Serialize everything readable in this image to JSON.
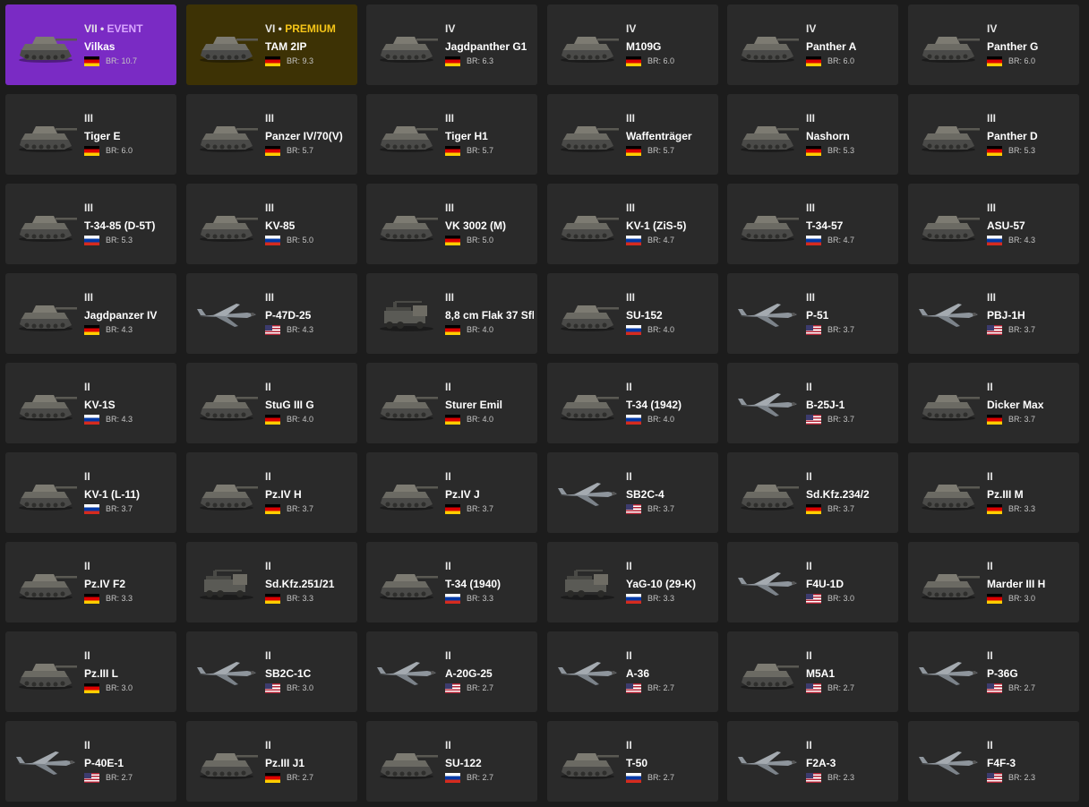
{
  "colors": {
    "page_background": "#1c1c1c",
    "card_background": "#2a2a2a",
    "event_background": "#7a2bc4",
    "premium_background": "#3d3205",
    "event_accent": "#d9a6ff",
    "premium_accent": "#f5c518"
  },
  "vehicles": [
    {
      "tier": "VII",
      "tag": "EVENT",
      "name": "Vilkas",
      "nation": "de",
      "br": "BR: 10.7",
      "kind": "tank",
      "variant": "event"
    },
    {
      "tier": "VI",
      "tag": "PREMIUM",
      "name": "TAM 2IP",
      "nation": "de",
      "br": "BR: 9.3",
      "kind": "tank",
      "variant": "premium"
    },
    {
      "tier": "IV",
      "name": "Jagdpanther G1",
      "nation": "de",
      "br": "BR: 6.3",
      "kind": "tank"
    },
    {
      "tier": "IV",
      "name": "M109G",
      "nation": "de",
      "br": "BR: 6.0",
      "kind": "tank"
    },
    {
      "tier": "IV",
      "name": "Panther A",
      "nation": "de",
      "br": "BR: 6.0",
      "kind": "tank"
    },
    {
      "tier": "IV",
      "name": "Panther G",
      "nation": "de",
      "br": "BR: 6.0",
      "kind": "tank"
    },
    {
      "tier": "III",
      "name": "Tiger E",
      "nation": "de",
      "br": "BR: 6.0",
      "kind": "tank"
    },
    {
      "tier": "III",
      "name": "Panzer IV/70(V)",
      "nation": "de",
      "br": "BR: 5.7",
      "kind": "tank"
    },
    {
      "tier": "III",
      "name": "Tiger H1",
      "nation": "de",
      "br": "BR: 5.7",
      "kind": "tank"
    },
    {
      "tier": "III",
      "name": "Waffenträger",
      "nation": "de",
      "br": "BR: 5.7",
      "kind": "tank"
    },
    {
      "tier": "III",
      "name": "Nashorn",
      "nation": "de",
      "br": "BR: 5.3",
      "kind": "tank"
    },
    {
      "tier": "III",
      "name": "Panther D",
      "nation": "de",
      "br": "BR: 5.3",
      "kind": "tank"
    },
    {
      "tier": "III",
      "name": "T-34-85 (D-5T)",
      "nation": "ru",
      "br": "BR: 5.3",
      "kind": "tank"
    },
    {
      "tier": "III",
      "name": "KV-85",
      "nation": "ru",
      "br": "BR: 5.0",
      "kind": "tank"
    },
    {
      "tier": "III",
      "name": "VK 3002 (M)",
      "nation": "de",
      "br": "BR: 5.0",
      "kind": "tank"
    },
    {
      "tier": "III",
      "name": "KV-1 (ZiS-5)",
      "nation": "ru",
      "br": "BR: 4.7",
      "kind": "tank"
    },
    {
      "tier": "III",
      "name": "T-34-57",
      "nation": "ru",
      "br": "BR: 4.7",
      "kind": "tank"
    },
    {
      "tier": "III",
      "name": "ASU-57",
      "nation": "ru",
      "br": "BR: 4.3",
      "kind": "tank"
    },
    {
      "tier": "III",
      "name": "Jagdpanzer IV",
      "nation": "de",
      "br": "BR: 4.3",
      "kind": "tank"
    },
    {
      "tier": "III",
      "name": "P-47D-25",
      "nation": "us",
      "br": "BR: 4.3",
      "kind": "plane"
    },
    {
      "tier": "III",
      "name": "8,8 cm Flak 37 Sfl.",
      "nation": "de",
      "br": "BR: 4.0",
      "kind": "truck"
    },
    {
      "tier": "III",
      "name": "SU-152",
      "nation": "ru",
      "br": "BR: 4.0",
      "kind": "tank"
    },
    {
      "tier": "III",
      "name": "P-51",
      "nation": "us",
      "br": "BR: 3.7",
      "kind": "plane"
    },
    {
      "tier": "III",
      "name": "PBJ-1H",
      "nation": "us",
      "br": "BR: 3.7",
      "kind": "plane"
    },
    {
      "tier": "II",
      "name": "KV-1S",
      "nation": "ru",
      "br": "BR: 4.3",
      "kind": "tank"
    },
    {
      "tier": "II",
      "name": "StuG III G",
      "nation": "de",
      "br": "BR: 4.0",
      "kind": "tank"
    },
    {
      "tier": "II",
      "name": "Sturer Emil",
      "nation": "de",
      "br": "BR: 4.0",
      "kind": "tank"
    },
    {
      "tier": "II",
      "name": "T-34 (1942)",
      "nation": "ru",
      "br": "BR: 4.0",
      "kind": "tank"
    },
    {
      "tier": "II",
      "name": "B-25J-1",
      "nation": "us",
      "br": "BR: 3.7",
      "kind": "plane"
    },
    {
      "tier": "II",
      "name": "Dicker Max",
      "nation": "de",
      "br": "BR: 3.7",
      "kind": "tank"
    },
    {
      "tier": "II",
      "name": "KV-1 (L-11)",
      "nation": "ru",
      "br": "BR: 3.7",
      "kind": "tank"
    },
    {
      "tier": "II",
      "name": "Pz.IV H",
      "nation": "de",
      "br": "BR: 3.7",
      "kind": "tank"
    },
    {
      "tier": "II",
      "name": "Pz.IV J",
      "nation": "de",
      "br": "BR: 3.7",
      "kind": "tank"
    },
    {
      "tier": "II",
      "name": "SB2C-4",
      "nation": "us",
      "br": "BR: 3.7",
      "kind": "plane"
    },
    {
      "tier": "II",
      "name": "Sd.Kfz.234/2",
      "nation": "de",
      "br": "BR: 3.7",
      "kind": "tank"
    },
    {
      "tier": "II",
      "name": "Pz.III M",
      "nation": "de",
      "br": "BR: 3.3",
      "kind": "tank"
    },
    {
      "tier": "II",
      "name": "Pz.IV F2",
      "nation": "de",
      "br": "BR: 3.3",
      "kind": "tank"
    },
    {
      "tier": "II",
      "name": "Sd.Kfz.251/21",
      "nation": "de",
      "br": "BR: 3.3",
      "kind": "truck"
    },
    {
      "tier": "II",
      "name": "T-34 (1940)",
      "nation": "ru",
      "br": "BR: 3.3",
      "kind": "tank"
    },
    {
      "tier": "II",
      "name": "YaG-10 (29-K)",
      "nation": "ru",
      "br": "BR: 3.3",
      "kind": "truck"
    },
    {
      "tier": "II",
      "name": "F4U-1D",
      "nation": "us",
      "br": "BR: 3.0",
      "kind": "plane"
    },
    {
      "tier": "II",
      "name": "Marder III H",
      "nation": "de",
      "br": "BR: 3.0",
      "kind": "tank"
    },
    {
      "tier": "II",
      "name": "Pz.III L",
      "nation": "de",
      "br": "BR: 3.0",
      "kind": "tank"
    },
    {
      "tier": "II",
      "name": "SB2C-1C",
      "nation": "us",
      "br": "BR: 3.0",
      "kind": "plane"
    },
    {
      "tier": "II",
      "name": "A-20G-25",
      "nation": "us",
      "br": "BR: 2.7",
      "kind": "plane"
    },
    {
      "tier": "II",
      "name": "A-36",
      "nation": "us",
      "br": "BR: 2.7",
      "kind": "plane"
    },
    {
      "tier": "II",
      "name": "M5A1",
      "nation": "us",
      "br": "BR: 2.7",
      "kind": "tank"
    },
    {
      "tier": "II",
      "name": "P-36G",
      "nation": "us",
      "br": "BR: 2.7",
      "kind": "plane"
    },
    {
      "tier": "II",
      "name": "P-40E-1",
      "nation": "us",
      "br": "BR: 2.7",
      "kind": "plane"
    },
    {
      "tier": "II",
      "name": "Pz.III J1",
      "nation": "de",
      "br": "BR: 2.7",
      "kind": "tank"
    },
    {
      "tier": "II",
      "name": "SU-122",
      "nation": "ru",
      "br": "BR: 2.7",
      "kind": "tank"
    },
    {
      "tier": "II",
      "name": "T-50",
      "nation": "ru",
      "br": "BR: 2.7",
      "kind": "tank"
    },
    {
      "tier": "II",
      "name": "F2A-3",
      "nation": "us",
      "br": "BR: 2.3",
      "kind": "plane"
    },
    {
      "tier": "II",
      "name": "F4F-3",
      "nation": "us",
      "br": "BR: 2.3",
      "kind": "plane"
    }
  ]
}
